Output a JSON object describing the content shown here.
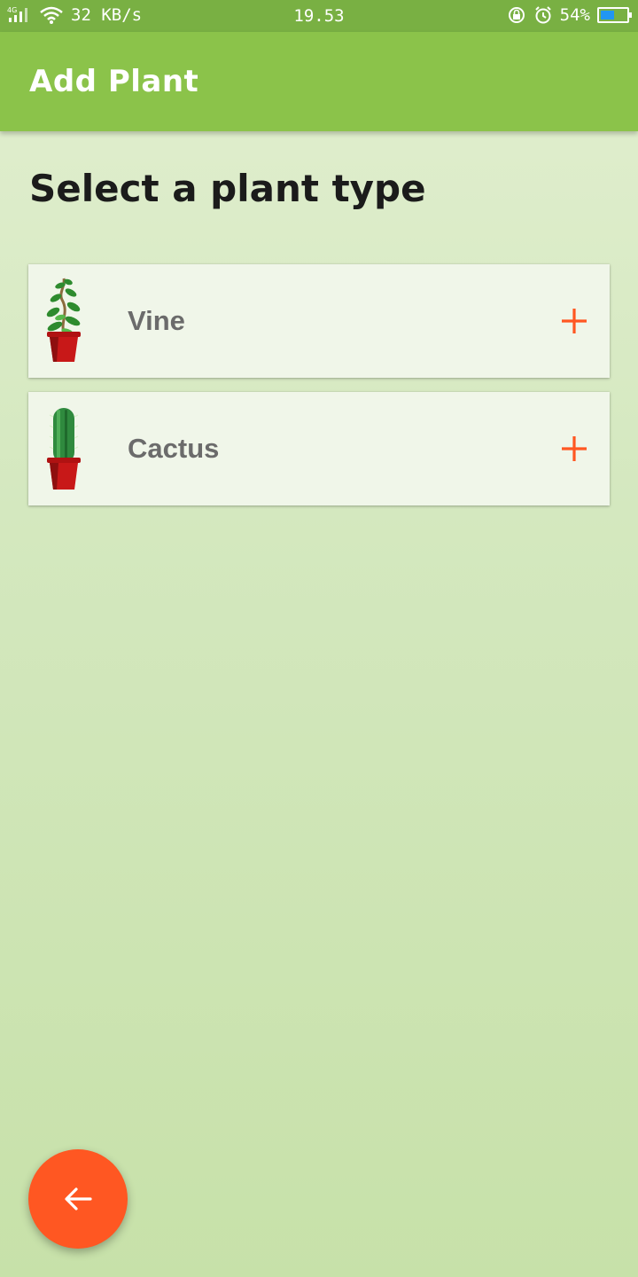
{
  "status_bar": {
    "network": "4G",
    "speed": "32 KB/s",
    "time": "19.53",
    "battery_percent": "54%",
    "battery_level": 0.54,
    "icons": [
      "signal-icon",
      "wifi-icon",
      "rotation-lock-icon",
      "alarm-icon",
      "battery-icon"
    ]
  },
  "toolbar": {
    "title": "Add Plant"
  },
  "main": {
    "heading": "Select a plant type",
    "plants": [
      {
        "label": "Vine",
        "icon": "vine-plant-icon"
      },
      {
        "label": "Cactus",
        "icon": "cactus-plant-icon"
      }
    ]
  },
  "fab": {
    "icon": "arrow-back-icon"
  },
  "colors": {
    "status_bar": "#79b043",
    "toolbar": "#8bc34a",
    "accent": "#ff5722",
    "card": "#f0f6e9",
    "label": "#6b6b6b"
  }
}
